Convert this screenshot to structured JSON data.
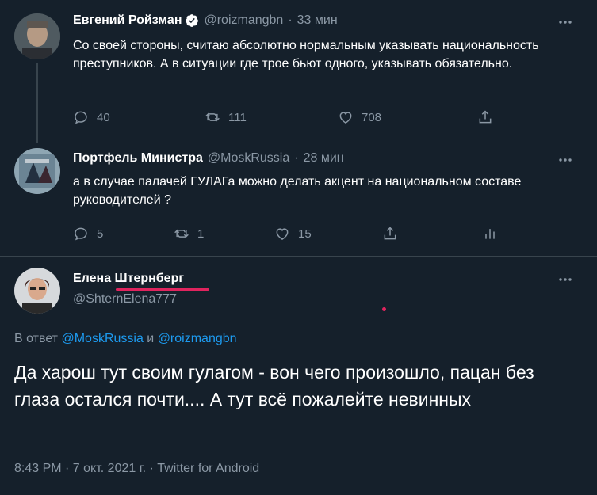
{
  "tweets": [
    {
      "name": "Евгений Ройзман",
      "handle": "@roizmangbn",
      "time": "33 мин",
      "verified": true,
      "text": "Со своей стороны, считаю абсолютно нормальным указывать национальность преступников. А в ситуации где трое бьют одного, указывать обязательно.",
      "replies": "40",
      "retweets": "111",
      "likes": "708"
    },
    {
      "name": "Портфель Министра",
      "handle": "@MoskRussia",
      "time": "28 мин",
      "text": "а в случае палачей ГУЛАГа можно делать акцент на национальном составе руководителей ?",
      "replies": "5",
      "retweets": "1",
      "likes": "15"
    }
  ],
  "main_tweet": {
    "name": "Елена Штернберг",
    "handle": "@ShternElena777",
    "reply_prefix": "В ответ",
    "reply_to_1": "@MoskRussia",
    "reply_and": "и",
    "reply_to_2": "@roizmangbn",
    "text": "Да харош тут своим гулагом - вон чего произошло, пацан без глаза остался почти.... А тут всё пожалейте невинных",
    "meta": "8:43 PM · 7 окт. 2021 г. · Twitter for Android"
  },
  "colors": {
    "background": "#15202b",
    "secondary_text": "#8b98a5",
    "link": "#1d9bf0",
    "underline_annotation": "#e0245e",
    "verified": "#ffffff"
  },
  "icons": [
    "verified-icon",
    "reply-icon",
    "retweet-icon",
    "like-icon",
    "share-icon",
    "analytics-icon",
    "more-icon"
  ]
}
